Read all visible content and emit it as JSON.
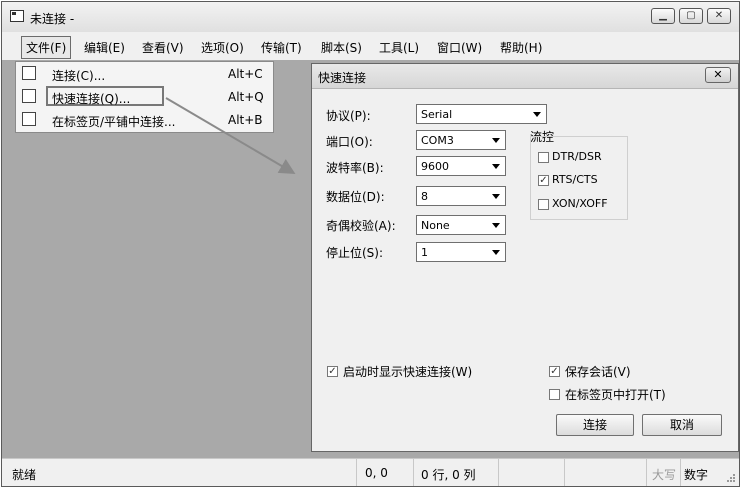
{
  "window": {
    "title": "未连接 -"
  },
  "menubar": {
    "items": [
      {
        "label": "文件(F)",
        "active": true
      },
      {
        "label": "编辑(E)"
      },
      {
        "label": "查看(V)"
      },
      {
        "label": "选项(O)"
      },
      {
        "label": "传输(T)"
      },
      {
        "label": "脚本(S)"
      },
      {
        "label": "工具(L)"
      },
      {
        "label": "窗口(W)"
      },
      {
        "label": "帮助(H)"
      }
    ]
  },
  "file_menu": {
    "items": [
      {
        "label": "连接(C)...",
        "shortcut": "Alt+C",
        "icon": "connect-icon"
      },
      {
        "label": "快速连接(Q)...",
        "shortcut": "Alt+Q",
        "icon": "quick-connect-icon",
        "highlighted": true
      },
      {
        "label": "在标签页/平铺中连接...",
        "shortcut": "Alt+B",
        "icon": "connect-in-tab-icon"
      }
    ]
  },
  "dialog": {
    "title": "快速连接",
    "close": "✕",
    "protocol": {
      "label": "协议(P):",
      "value": "Serial"
    },
    "port": {
      "label": "端口(O):",
      "value": "COM3"
    },
    "baud": {
      "label": "波特率(B):",
      "value": "9600"
    },
    "databits": {
      "label": "数据位(D):",
      "value": "8"
    },
    "parity": {
      "label": "奇偶校验(A):",
      "value": "None"
    },
    "stopbits": {
      "label": "停止位(S):",
      "value": "1"
    },
    "flow": {
      "label": "流控",
      "options": [
        {
          "label": "DTR/DSR",
          "checked": false
        },
        {
          "label": "RTS/CTS",
          "checked": true
        },
        {
          "label": "XON/XOFF",
          "checked": false
        }
      ]
    },
    "show_on_startup": {
      "label": "启动时显示快速连接(W)",
      "checked": true
    },
    "save_session": {
      "label": "保存会话(V)",
      "checked": true
    },
    "open_in_tab": {
      "label": "在标签页中打开(T)",
      "checked": false
    },
    "connect_btn": "连接",
    "cancel_btn": "取消"
  },
  "statusbar": {
    "status": "就绪",
    "position": "0, 0",
    "rows_cols": "0 行, 0 列",
    "caps": "大写",
    "num": "数字"
  },
  "colors": {
    "workspace": "#a9a9a9",
    "dialog_bg": "#f0f0f0",
    "arrow": "#8a8a8a"
  }
}
